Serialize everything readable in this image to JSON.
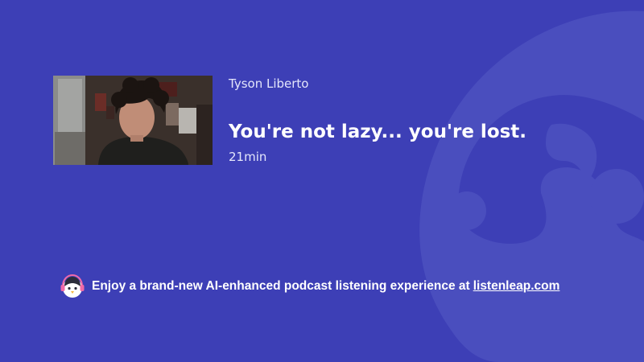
{
  "episode": {
    "author": "Tyson Liberto",
    "title": "You're not lazy... you're lost.",
    "duration": "21min"
  },
  "promo": {
    "text": "Enjoy a brand-new AI-enhanced podcast listening experience at",
    "link_text": "listenleap.com"
  },
  "colors": {
    "background": "#3d3fb6",
    "watermark": "#4a4ebe",
    "text": "#ffffff"
  },
  "icons": {
    "background": "listenleap-logo-watermark",
    "promo": "penguin-headphones-icon"
  }
}
